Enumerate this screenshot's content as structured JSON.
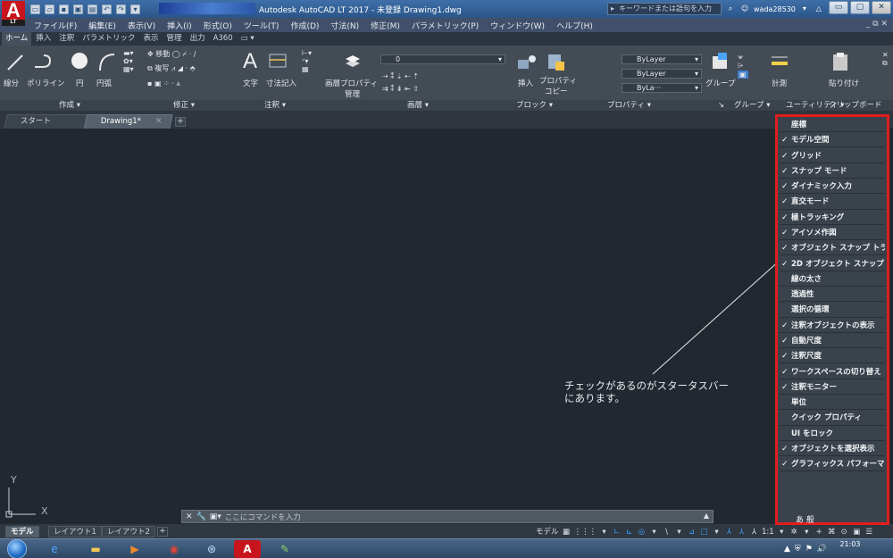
{
  "window": {
    "title": "Autodesk AutoCAD LT 2017 - 未登録   Drawing1.dwg",
    "app_logo": "A",
    "app_badge": "LT",
    "search_placeholder": "キーワードまたは語句を入力",
    "user": "wada28530",
    "controls": [
      "▭",
      "▢",
      "✕"
    ]
  },
  "menubar": {
    "items": [
      "ファイル(F)",
      "編集(E)",
      "表示(V)",
      "挿入(I)",
      "形式(O)",
      "ツール(T)",
      "作成(D)",
      "寸法(N)",
      "修正(M)",
      "パラメトリック(P)",
      "ウィンドウ(W)",
      "ヘルプ(H)"
    ],
    "right": "_ ⧉ ✕"
  },
  "ribbon_tabs": [
    "ホーム",
    "挿入",
    "注釈",
    "パラメトリック",
    "表示",
    "管理",
    "出力",
    "A360",
    "▭ ▾"
  ],
  "ribbon": {
    "tools": {
      "line": "線分",
      "polyline": "ポリライン",
      "circle": "円",
      "arc": "円弧",
      "move": "移動",
      "copy": "複写",
      "text": "文字",
      "dimension": "寸法記入",
      "layer_props": "画層プロパティ",
      "layer_props2": "管理",
      "layer_value": "0",
      "insert": "挿入",
      "properties": "プロパティ",
      "properties2": "コピー",
      "bylayer1": "ByLayer",
      "bylayer2": "ByLayer",
      "bylayer3": "ByLa···",
      "group": "グループ",
      "measure": "計測",
      "paste": "貼り付け"
    },
    "panels": [
      "作成 ▾",
      "修正 ▾",
      "注釈 ▾",
      "画層 ▾",
      "ブロック ▾",
      "プロパティ ▾",
      "↘",
      "グループ ▾",
      "ユーティリティ ▾",
      "クリップボード"
    ]
  },
  "doc_tabs": {
    "start": "スタート",
    "drawing": "Drawing1*",
    "close": "✕",
    "add": "+"
  },
  "canvas": {
    "annotation": "チェックがあるのがスタータスバー\nにあります。",
    "ucs_x": "X",
    "ucs_y": "Y"
  },
  "command": {
    "placeholder": "ここにコマンドを入力",
    "close": "✕",
    "search": "🔧",
    "history": "▣▾"
  },
  "layout_tabs": [
    "モデル",
    "レイアウト1",
    "レイアウト2"
  ],
  "layout_add": "+",
  "status_tools": [
    "モデル",
    "▦",
    "⋮⋮⋮",
    "▾",
    "∟",
    "⊾",
    "◎",
    "▾",
    "\\",
    "▾",
    "⊿",
    "□",
    "▾",
    "⅄",
    "⅄",
    "⅄",
    "1:1",
    "▾",
    "✲",
    "▾",
    "+",
    "⌘",
    "⊙",
    "▣",
    "☰"
  ],
  "status_menu": {
    "items": [
      {
        "label": "座標",
        "checked": false
      },
      {
        "label": "モデル空間",
        "checked": true
      },
      {
        "label": "グリッド",
        "checked": true
      },
      {
        "label": "スナップ モード",
        "checked": true
      },
      {
        "label": "ダイナミック入力",
        "checked": true
      },
      {
        "label": "直交モード",
        "checked": true
      },
      {
        "label": "極トラッキング",
        "checked": true
      },
      {
        "label": "アイソメ作図",
        "checked": true
      },
      {
        "label": "オブジェクト スナップ トラッキング",
        "checked": true
      },
      {
        "label": "2D オブジェクト スナップ",
        "checked": true
      },
      {
        "label": "線の太さ",
        "checked": false
      },
      {
        "label": "透過性",
        "checked": false
      },
      {
        "label": "選択の循環",
        "checked": false
      },
      {
        "label": "注釈オブジェクトの表示",
        "checked": true
      },
      {
        "label": "自動尺度",
        "checked": true
      },
      {
        "label": "注釈尺度",
        "checked": true
      },
      {
        "label": "ワークスペースの切り替え",
        "checked": true
      },
      {
        "label": "注釈モニター",
        "checked": true
      },
      {
        "label": "単位",
        "checked": false
      },
      {
        "label": "クイック プロパティ",
        "checked": false
      },
      {
        "label": "UI をロック",
        "checked": false
      },
      {
        "label": "オブジェクトを選択表示",
        "checked": true
      },
      {
        "label": "グラフィックス パフォーマンス",
        "checked": true
      }
    ],
    "check_glyph": "✓",
    "border_color": "#e01e1e",
    "overflow_text": "あ 般"
  },
  "taskbar": {
    "clock_time": "21:03",
    "tray_icons": [
      "▲",
      "⛨",
      "⚑",
      "🔊"
    ]
  }
}
